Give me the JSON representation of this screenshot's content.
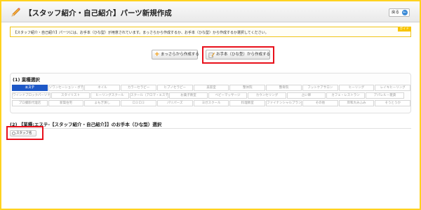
{
  "header": {
    "title": "【スタッフ紹介・自己紹介】パーツ新規作成",
    "back_label": "戻る"
  },
  "info": {
    "text": "【スタッフ紹介・自己紹介】パーツには、お手本（ひな型）が用意されています。まっさらから作成するか、お手本（ひな型）から作成するか選択してください。",
    "guide_label": "ガイド"
  },
  "actions": {
    "scratch_label": "まっさらから作成する",
    "template_label": "お手本（ひな型）から作成する"
  },
  "section1": {
    "title": "(1) 業種選択",
    "categories": [
      [
        "エステ",
        "ソワンセーション・ボディケア",
        "ネイル",
        "カラーセラピー",
        "ヒプノセラピー",
        "美容室",
        "整体院",
        "整骨院",
        "フットケアサロン",
        "ヒーリング",
        "レイキヒーリング"
      ],
      [
        "ワインドブロックパーソナ",
        "スタイリスト",
        "ヒーリングスクール",
        "スクール（アロマ・エステ・カラー等）",
        "お菓子教室",
        "ベビーマッサージ",
        "カウンセリング",
        "占い師",
        "カフェ・レストラン",
        "アパレル・雑貨"
      ],
      [
        "プロ撮影代理店",
        "新築住宅",
        "よもぎ蒸し",
        "ロミロミ",
        "パリパーズ",
        "ヨガスクール",
        "料理教室",
        "ファイナンシャルプランナー",
        "その他",
        "岸和大みふみ",
        "そうとうか"
      ]
    ]
  },
  "section2": {
    "title": "(2) 【業種:エステ-【スタッフ紹介・自己紹介】】のお手本（ひな型）選択",
    "staff_label": "スタッフ名"
  }
}
